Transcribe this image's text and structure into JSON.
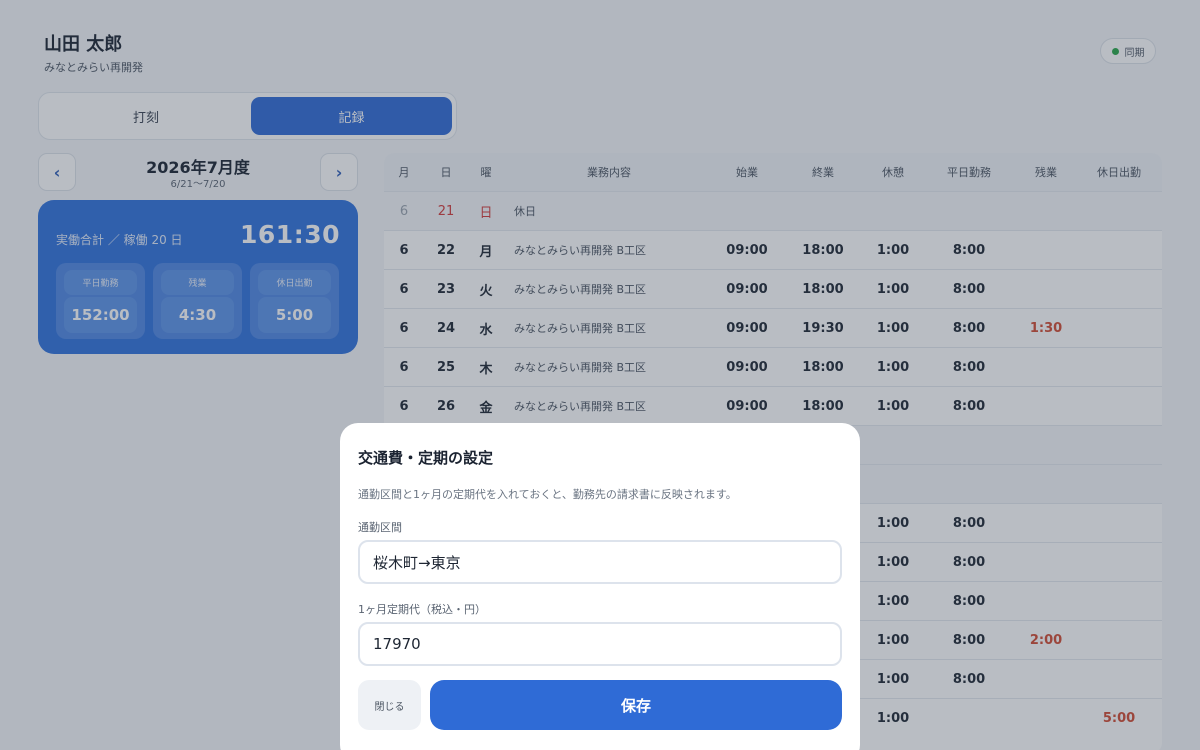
{
  "header": {
    "user_name": "山田 太郎",
    "site_name": "みなとみらい再開発",
    "sync_label": "同期",
    "sync_status_color": "#2aa84a"
  },
  "mode_tabs": [
    {
      "label": "打刻",
      "active": false
    },
    {
      "label": "記録",
      "active": true
    }
  ],
  "period": {
    "title": "2026年7月度",
    "range": "6/21〜7/20",
    "prev_icon": "chevron-left",
    "next_icon": "chevron-right"
  },
  "summary": {
    "label": "実働合計 ／ 稼働 20 日",
    "total": "161:30",
    "items": [
      {
        "label": "平日勤務",
        "value": "152:00"
      },
      {
        "label": "残業",
        "value": "4:30"
      },
      {
        "label": "休日出勤",
        "value": "5:00"
      }
    ]
  },
  "records": {
    "columns": [
      "月",
      "日",
      "曜",
      "業務内容",
      "始業",
      "終業",
      "休憩",
      "平日勤務",
      "残業",
      "休日出勤"
    ],
    "rows": [
      {
        "month": "6",
        "day": "21",
        "dow": "日",
        "job": "休日",
        "start": "",
        "end": "",
        "break": "",
        "weekday": "",
        "overtime": "",
        "holiday_work": "",
        "is_holiday": true
      },
      {
        "month": "6",
        "day": "22",
        "dow": "月",
        "job": "みなとみらい再開発 B工区",
        "start": "09:00",
        "end": "18:00",
        "break": "1:00",
        "weekday": "8:00",
        "overtime": "",
        "holiday_work": "",
        "is_holiday": false
      },
      {
        "month": "6",
        "day": "23",
        "dow": "火",
        "job": "みなとみらい再開発 B工区",
        "start": "09:00",
        "end": "18:00",
        "break": "1:00",
        "weekday": "8:00",
        "overtime": "",
        "holiday_work": "",
        "is_holiday": false
      },
      {
        "month": "6",
        "day": "24",
        "dow": "水",
        "job": "みなとみらい再開発 B工区",
        "start": "09:00",
        "end": "19:30",
        "break": "1:00",
        "weekday": "8:00",
        "overtime": "1:30",
        "holiday_work": "",
        "is_holiday": false
      },
      {
        "month": "6",
        "day": "25",
        "dow": "木",
        "job": "みなとみらい再開発 B工区",
        "start": "09:00",
        "end": "18:00",
        "break": "1:00",
        "weekday": "8:00",
        "overtime": "",
        "holiday_work": "",
        "is_holiday": false
      },
      {
        "month": "6",
        "day": "26",
        "dow": "金",
        "job": "みなとみらい再開発 B工区",
        "start": "09:00",
        "end": "18:00",
        "break": "1:00",
        "weekday": "8:00",
        "overtime": "",
        "holiday_work": "",
        "is_holiday": false
      },
      {
        "month": "",
        "day": "",
        "dow": "",
        "job": "",
        "start": "",
        "end": "",
        "break": "",
        "weekday": "",
        "overtime": "",
        "holiday_work": "",
        "is_holiday": true
      },
      {
        "month": "",
        "day": "",
        "dow": "",
        "job": "",
        "start": "",
        "end": "",
        "break": "",
        "weekday": "",
        "overtime": "",
        "holiday_work": "",
        "is_holiday": true
      },
      {
        "month": "",
        "day": "",
        "dow": "",
        "job": "",
        "start": "",
        "end": "",
        "break": "1:00",
        "weekday": "8:00",
        "overtime": "",
        "holiday_work": "",
        "is_holiday": false
      },
      {
        "month": "",
        "day": "",
        "dow": "",
        "job": "",
        "start": "",
        "end": "",
        "break": "1:00",
        "weekday": "8:00",
        "overtime": "",
        "holiday_work": "",
        "is_holiday": false
      },
      {
        "month": "",
        "day": "",
        "dow": "",
        "job": "",
        "start": "",
        "end": "",
        "break": "1:00",
        "weekday": "8:00",
        "overtime": "",
        "holiday_work": "",
        "is_holiday": false
      },
      {
        "month": "",
        "day": "",
        "dow": "",
        "job": "",
        "start": "",
        "end": "",
        "break": "1:00",
        "weekday": "8:00",
        "overtime": "2:00",
        "holiday_work": "",
        "is_holiday": false
      },
      {
        "month": "",
        "day": "",
        "dow": "",
        "job": "",
        "start": "",
        "end": "",
        "break": "1:00",
        "weekday": "8:00",
        "overtime": "",
        "holiday_work": "",
        "is_holiday": false
      },
      {
        "month": "",
        "day": "",
        "dow": "",
        "job": "",
        "start": "",
        "end": "",
        "break": "1:00",
        "weekday": "",
        "overtime": "",
        "holiday_work": "5:00",
        "is_holiday": false
      }
    ]
  },
  "modal": {
    "title": "交通費・定期の設定",
    "description": "通勤区間と1ヶ月の定期代を入れておくと、勤務先の請求書に反映されます。",
    "route_label": "通勤区間",
    "route_value": "桜木町→東京",
    "fare_label": "1ヶ月定期代（税込・円）",
    "fare_value": "17970",
    "close_label": "閉じる",
    "save_label": "保存"
  }
}
